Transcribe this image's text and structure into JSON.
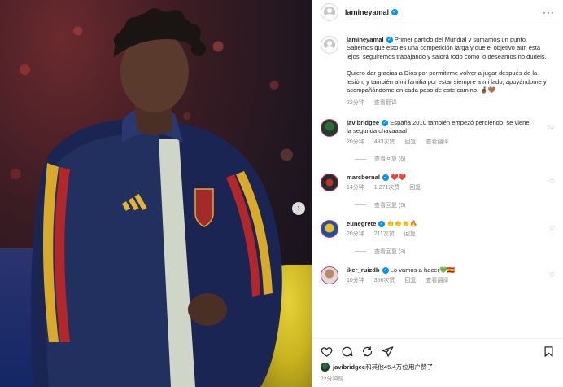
{
  "post": {
    "username": "lamineyamal",
    "caption_p1": "Primer partido del Mundial y sumamos un punto. Sabemos que esto es una competición larga y que el objetivo aún está lejos, seguiremos trabajando y saldrá todo como lo deseamos no dudéis.",
    "caption_p2": "Quiero dar gracias a Dios por permitirme volver a jugar después de la lesión, y también a mi familia por estar siempre a mi lado, apoyándome y acompañándome en cada paso de este camino. 🤞🏾🤎",
    "time": "22分钟",
    "view_translation": "查看翻译"
  },
  "comments": [
    {
      "username": "javibridgee",
      "verified": true,
      "text": "España 2010 también empezó perdiendo, se viene la segunda chavaaaal",
      "time": "20分钟",
      "likes": "483次赞",
      "reply": "回复",
      "translate": "查看翻译",
      "replies": "查看回复 (6)"
    },
    {
      "username": "marcbernal",
      "verified": true,
      "text": "❤️❤️",
      "time": "14分钟",
      "likes": "1,271次赞",
      "reply": "回复",
      "replies": "查看回复 (5)"
    },
    {
      "username": "eunegrete",
      "verified": true,
      "text": "👏👏👏🔥",
      "time": "20分钟",
      "likes": "211次赞",
      "reply": "回复",
      "replies": "查看回复 (3)"
    },
    {
      "username": "iker_ruizdb",
      "verified": true,
      "text": "Lo vamos a hacer💚🇪🇸",
      "time": "10分钟",
      "likes": "356次赞",
      "reply": "回复",
      "translate": "查看翻译"
    }
  ],
  "likes_line": {
    "user": "javibridgee",
    "rest": "和其他45.4万位用户赞了"
  },
  "footer_time": "22分钟前",
  "icons": [
    "heart-icon",
    "comment-icon",
    "share-icon",
    "send-icon",
    "bookmark-icon",
    "more-icon",
    "next-slide-icon"
  ]
}
